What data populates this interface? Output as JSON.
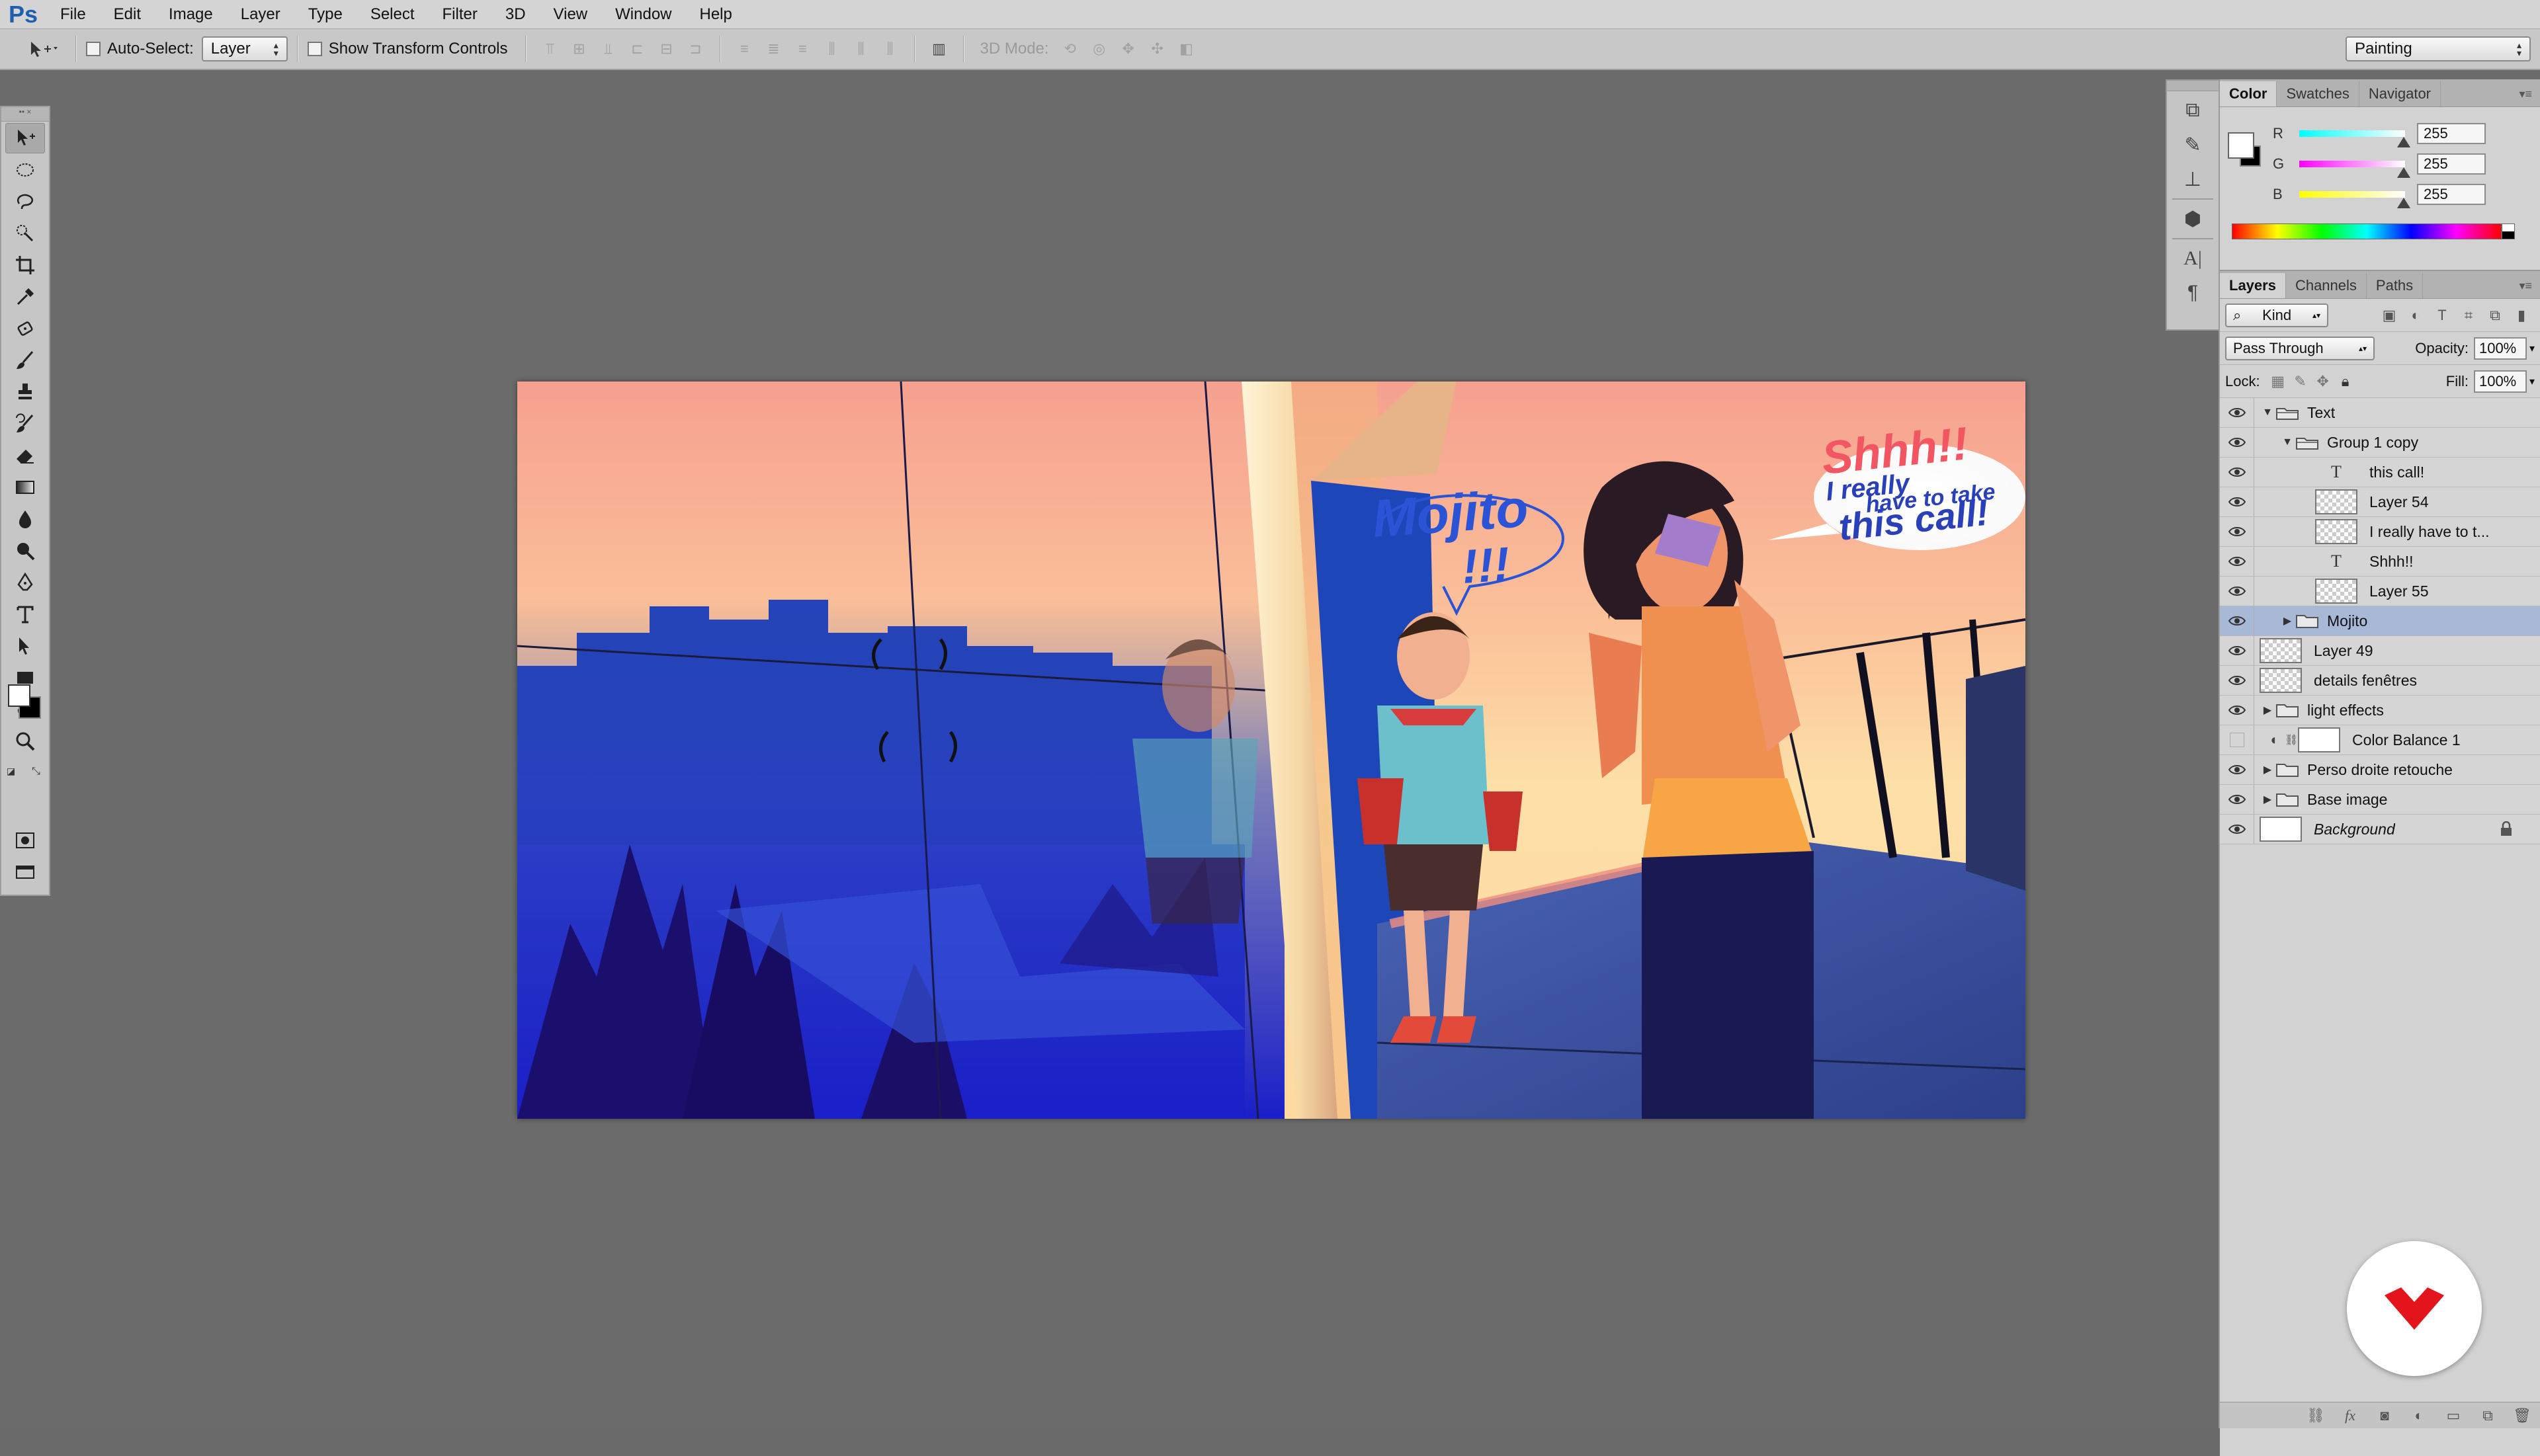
{
  "app": {
    "logo_text": "Ps",
    "menu": [
      "File",
      "Edit",
      "Image",
      "Layer",
      "Type",
      "Select",
      "Filter",
      "3D",
      "View",
      "Window",
      "Help"
    ]
  },
  "options_bar": {
    "auto_select_label": "Auto-Select:",
    "auto_select_checked": false,
    "auto_select_target": "Layer",
    "show_transform_label": "Show Transform Controls",
    "show_transform_checked": false,
    "mode_3d_label": "3D Mode:",
    "workspace": "Painting"
  },
  "tools": {
    "foreground_color": "#ffffff",
    "background_color": "#000000"
  },
  "color_panel": {
    "tabs": [
      "Color",
      "Swatches",
      "Navigator"
    ],
    "active_tab": "Color",
    "channels": [
      {
        "label": "R",
        "value": "255"
      },
      {
        "label": "G",
        "value": "255"
      },
      {
        "label": "B",
        "value": "255"
      }
    ]
  },
  "layers_panel": {
    "tabs": [
      "Layers",
      "Channels",
      "Paths"
    ],
    "active_tab": "Layers",
    "filter_kind": "Kind",
    "blend_mode": "Pass Through",
    "opacity_label": "Opacity:",
    "opacity": "100%",
    "lock_label": "Lock:",
    "fill_label": "Fill:",
    "fill": "100%",
    "layers": [
      {
        "name": "Text",
        "kind": "group",
        "indent": 0,
        "expanded": true,
        "visible": true
      },
      {
        "name": "Group 1 copy",
        "kind": "group",
        "indent": 1,
        "expanded": true,
        "visible": true
      },
      {
        "name": "this call!",
        "kind": "type",
        "indent": 2,
        "visible": true
      },
      {
        "name": "Layer 54",
        "kind": "pixel",
        "indent": 2,
        "visible": true
      },
      {
        "name": "I really have  to t...",
        "kind": "pixel",
        "indent": 2,
        "visible": true
      },
      {
        "name": "Shhh!!",
        "kind": "type",
        "indent": 2,
        "visible": true
      },
      {
        "name": "Layer 55",
        "kind": "pixel",
        "indent": 2,
        "visible": true
      },
      {
        "name": "Mojito",
        "kind": "group",
        "indent": 1,
        "expanded": false,
        "visible": true,
        "selected": true
      },
      {
        "name": "Layer 49",
        "kind": "pixel",
        "indent": 0,
        "visible": true
      },
      {
        "name": "details fenêtres",
        "kind": "pixel",
        "indent": 0,
        "visible": true
      },
      {
        "name": "light effects",
        "kind": "group",
        "indent": 0,
        "expanded": false,
        "visible": true
      },
      {
        "name": "Color Balance 1",
        "kind": "adjustment",
        "indent": 0,
        "visible": false
      },
      {
        "name": "Perso droite retouche",
        "kind": "group",
        "indent": 0,
        "expanded": false,
        "visible": true
      },
      {
        "name": "Base image",
        "kind": "group",
        "indent": 0,
        "expanded": false,
        "visible": true
      },
      {
        "name": "Background",
        "kind": "background",
        "indent": 0,
        "visible": true,
        "locked": true
      }
    ]
  },
  "artwork": {
    "mojito_text_1": "Mojito",
    "mojito_text_2": "!!!",
    "shhh_text": "Shhh!!",
    "bubble_line1": "I really",
    "bubble_line2": "have to take",
    "bubble_line3": "this call!"
  },
  "colors": {
    "accent_selected_row": "#a8b9d8",
    "badge_red": "#e3141b"
  }
}
